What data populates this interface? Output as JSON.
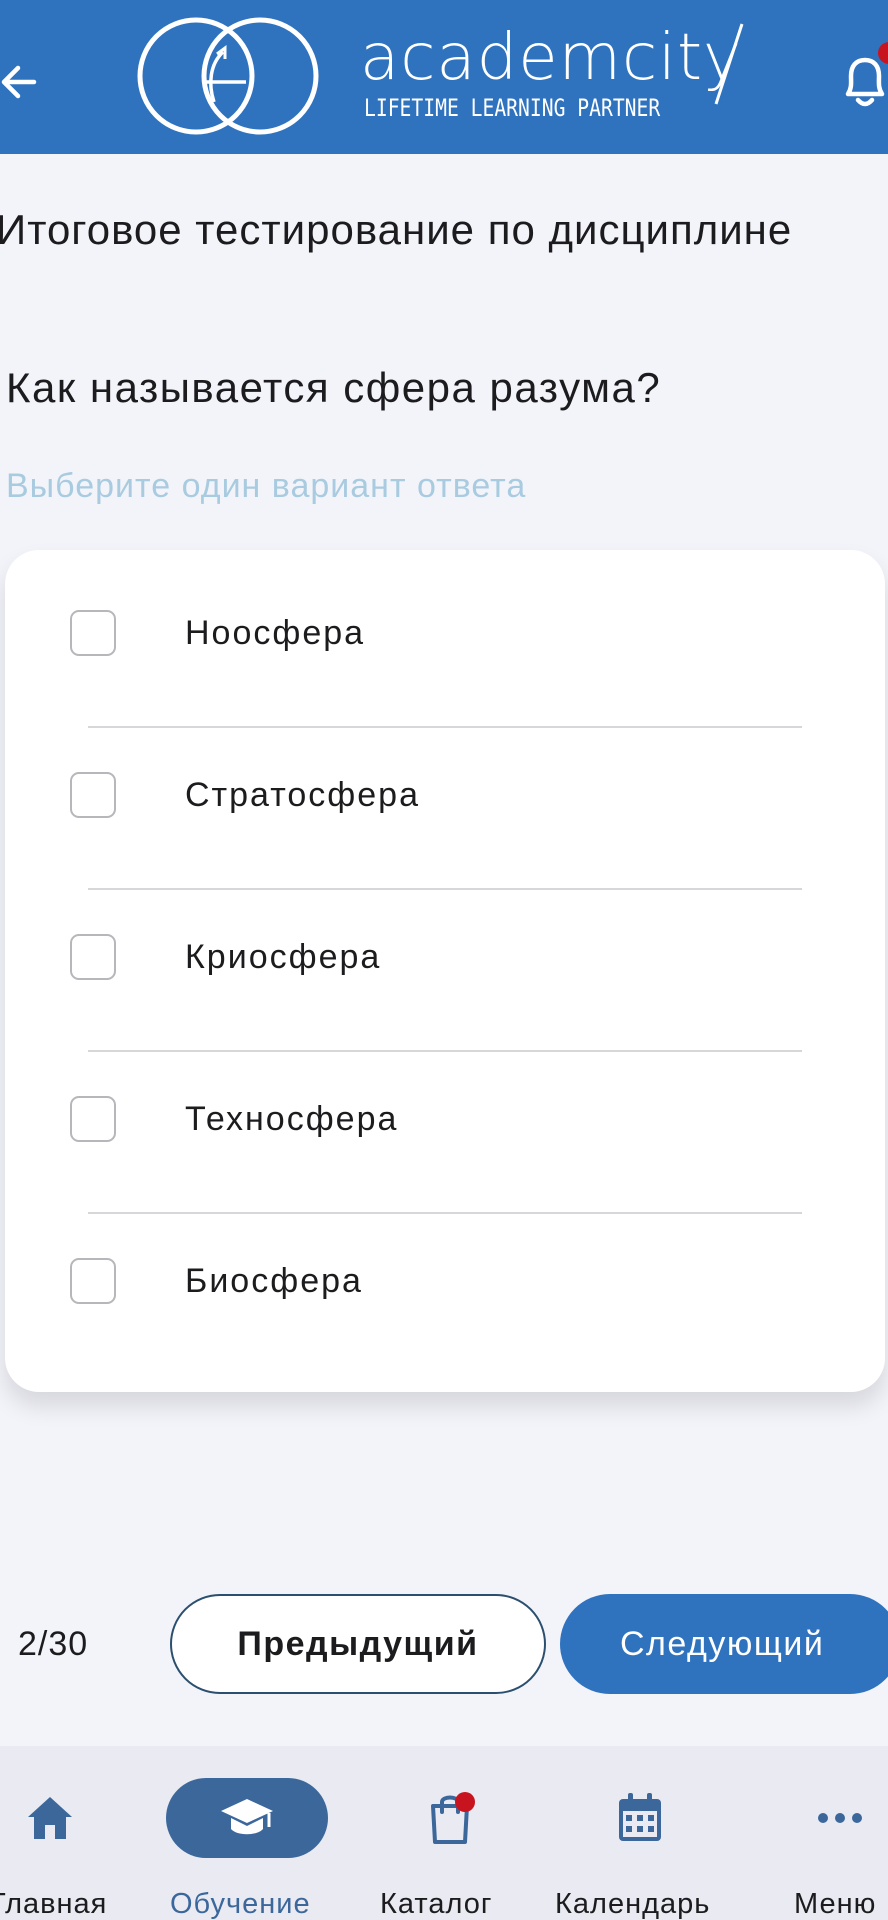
{
  "header": {
    "logo_word": "academcity",
    "logo_tagline": "LIFETIME LEARNING PARTNER",
    "colors": {
      "background": "#2f73bf",
      "notification_dot": "#c8141e"
    },
    "icons": [
      "back-arrow-icon",
      "bell-icon"
    ]
  },
  "page": {
    "title": "Итоговое тестирование по дисциплине",
    "question": "Как называется сфера разума?",
    "hint": "Выберите один вариант ответа"
  },
  "options": [
    {
      "label": "Ноосфера",
      "checked": false
    },
    {
      "label": "Стратосфера",
      "checked": false
    },
    {
      "label": "Криосфера",
      "checked": false
    },
    {
      "label": "Техносфера",
      "checked": false
    },
    {
      "label": "Биосфера",
      "checked": false
    }
  ],
  "pagination": {
    "counter": "2/30",
    "prev_label": "Предыдущий",
    "next_label": "Следующий"
  },
  "bottom_nav": {
    "items": [
      {
        "label": "Главная",
        "icon": "home-icon",
        "active": false,
        "badge": false
      },
      {
        "label": "Обучение",
        "icon": "graduation-cap-icon",
        "active": true,
        "badge": false
      },
      {
        "label": "Каталог",
        "icon": "shopping-bag-icon",
        "active": false,
        "badge": true
      },
      {
        "label": "Календарь",
        "icon": "calendar-icon",
        "active": false,
        "badge": false
      },
      {
        "label": "Меню",
        "icon": "more-dots-icon",
        "active": false,
        "badge": false
      }
    ],
    "colors": {
      "active": "#3b679b",
      "badge": "#c8141e"
    }
  }
}
